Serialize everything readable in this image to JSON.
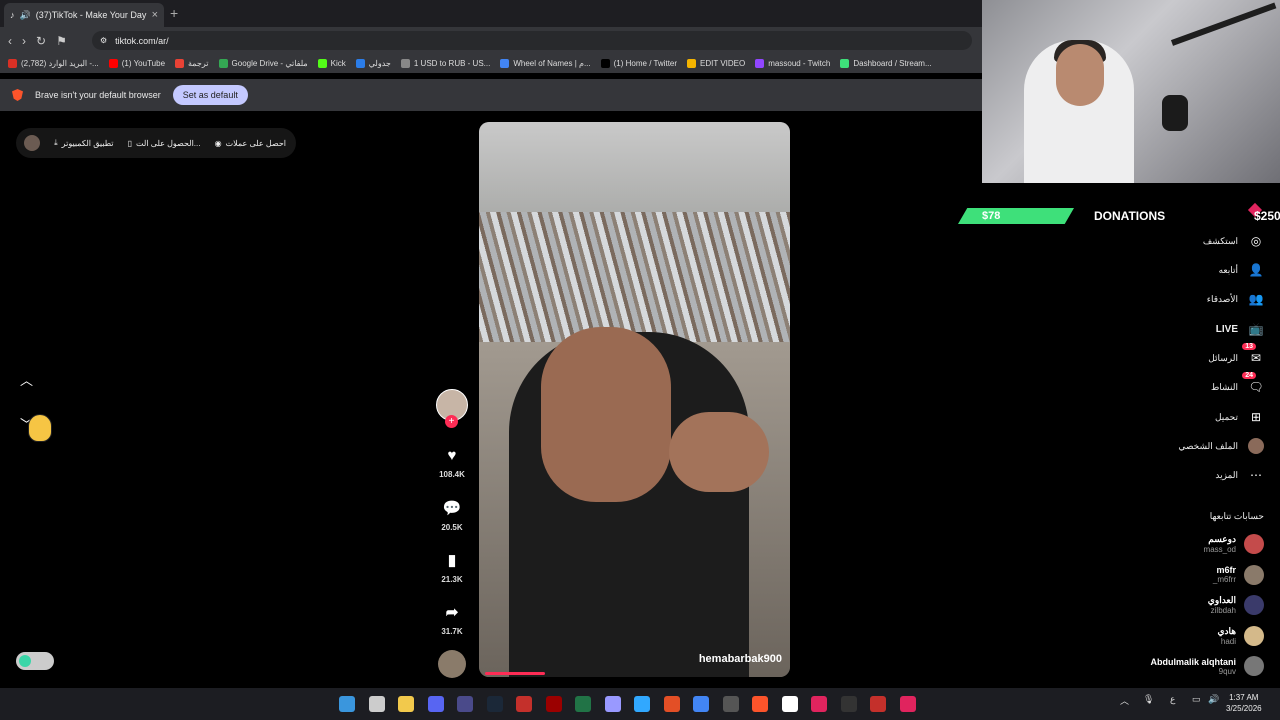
{
  "browser": {
    "tab_title": "(37)TikTok - Make Your Day",
    "new_tab": "+",
    "url": "tiktok.com/ar/",
    "bookmarks": [
      {
        "label": "(2,782) البريد الوارد -...",
        "color": "#d93025"
      },
      {
        "label": "(1) YouTube",
        "color": "#ff0000"
      },
      {
        "label": "ترجمة",
        "color": "#e94235"
      },
      {
        "label": "Google Drive - ملفاتي",
        "color": "#34a853"
      },
      {
        "label": "Kick",
        "color": "#53fc18"
      },
      {
        "label": "جدولي",
        "color": "#2b7de9"
      },
      {
        "label": "1 USD to RUB - US...",
        "color": "#888888"
      },
      {
        "label": "Wheel of Names | م...",
        "color": "#4285f4"
      },
      {
        "label": "(1) Home / Twitter",
        "color": "#000000"
      },
      {
        "label": "EDIT VIDEO",
        "color": "#f4b400"
      },
      {
        "label": "massoud - Twitch",
        "color": "#9146ff"
      },
      {
        "label": "Dashboard / Stream...",
        "color": "#3ee07a"
      }
    ],
    "infobar_text": "Brave isn't your default browser",
    "set_default_label": "Set as default"
  },
  "tiktok": {
    "top_buttons": {
      "coins": "احصل على عملات",
      "get_app": "الحصول على الت...",
      "desktop_app": "تطبيق الكمبيوتر"
    },
    "video": {
      "author": "hemabarbak900"
    },
    "actions": {
      "likes": "108.4K",
      "comments": "20.5K",
      "saves": "21.3K",
      "shares": "31.7K"
    },
    "nav": {
      "explore": "استكشف",
      "following": "أتابعه",
      "friends": "الأصدقاء",
      "live": "LIVE",
      "messages": "الرسائل",
      "messages_badge": "13",
      "activity": "النشاط",
      "activity_badge": "24",
      "upload": "تحميل",
      "profile": "الملف الشخصي",
      "more": "المزيد"
    },
    "following_title": "حسابات تتابعها",
    "following_accounts": [
      {
        "name": "دوعسم",
        "username": "mass_od",
        "color": "#c44b4b"
      },
      {
        "name": "m6fr",
        "username": "_m6frr",
        "color": "#8a7a6a"
      },
      {
        "name": "العداوي",
        "username": "zilbdah",
        "color": "#3a3a6a"
      },
      {
        "name": "هادي",
        "username": "hadi",
        "color": "#d4b98a"
      },
      {
        "name": "Abdulmalik alqhtani",
        "username": "9quv",
        "color": "#777777"
      }
    ]
  },
  "overlay": {
    "donation_amount_bar": "$78",
    "donations_label": "DONATIONS",
    "donation_goal": "$250"
  },
  "taskbar": {
    "language": "ع",
    "time": "1:37 AM",
    "date": "3/25/2026"
  }
}
